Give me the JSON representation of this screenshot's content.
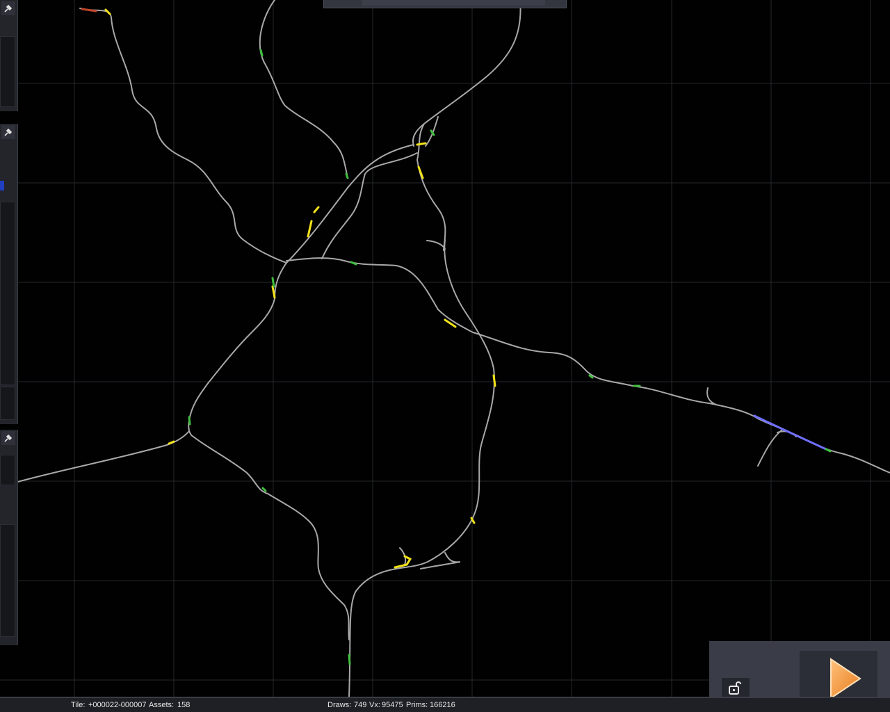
{
  "status_bar": {
    "tile_label": "Tile:",
    "tile_value": "+000022-000007",
    "assets_label": "Assets:",
    "assets_value": "158",
    "draws_label": "Draws:",
    "draws_value": "749",
    "vx_label": "Vx:",
    "vx_value": "95475",
    "prims_label": "Prims:",
    "prims_value": "166216"
  },
  "icons": {
    "pin": "pin-icon",
    "lock": "unlock-icon",
    "play": "play-icon"
  },
  "colors": {
    "grid": "#2a2c30",
    "road": "#a9a9a9",
    "highlight_yellow": "#f2e21a",
    "highlight_green": "#3fbf3f",
    "highlight_blue": "#6f6fff",
    "highlight_red": "#c0442a",
    "play_orange": "#f39a3c"
  }
}
